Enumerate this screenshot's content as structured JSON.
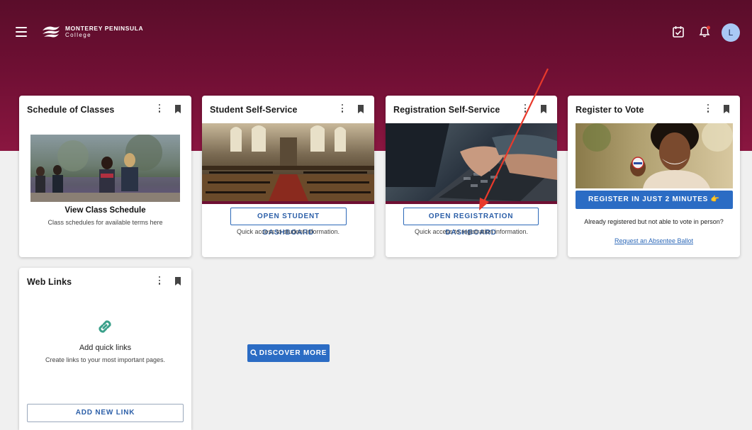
{
  "header": {
    "logo_line1": "MONTEREY PENINSULA",
    "logo_line2": "College",
    "avatar_initial": "L",
    "brand_color": "#6e0f33",
    "notification_dot_color": "#e53935"
  },
  "cards": {
    "schedule": {
      "title": "Schedule of Classes",
      "heading": "View Class Schedule",
      "subtext": "Class schedules for available terms here"
    },
    "student": {
      "title": "Student Self-Service",
      "button": "OPEN STUDENT DASHBOARD",
      "subtext": "Quick access to student information."
    },
    "registration": {
      "title": "Registration Self-Service",
      "button": "OPEN REGISTRATION DASHBOARD",
      "subtext": "Quick access to registration information."
    },
    "vote": {
      "title": "Register to Vote",
      "button": "REGISTER IN JUST 2 MINUTES",
      "button_emoji": "👉",
      "subtext": "Already registered but not able to vote in person?",
      "link": "Request an Absentee Ballot"
    },
    "weblinks": {
      "title": "Web Links",
      "heading": "Add quick links",
      "subtext": "Create links to your most important pages.",
      "button": "ADD NEW LINK"
    }
  },
  "discover": {
    "label": "DISCOVER MORE"
  }
}
